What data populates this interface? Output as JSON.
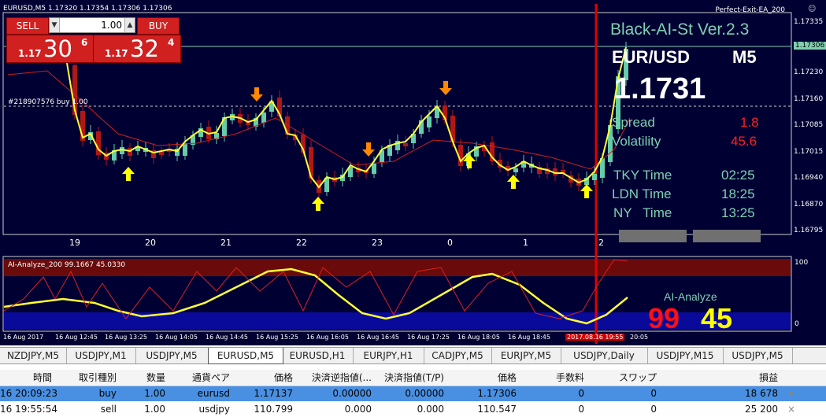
{
  "chart_header": "EURUSD,M5  1.17320 1.17354 1.17306 1.17306",
  "ea_name": "Perfect-Exit-EA_200",
  "trade_panel": {
    "sell_label": "SELL",
    "buy_label": "BUY",
    "lot": "1.00",
    "sell_small": "1.17",
    "sell_big": "30",
    "sell_sup": "6",
    "buy_small": "1.17",
    "buy_big": "32",
    "buy_sup": "4"
  },
  "order_line_label": "#218907576 buy 1.00",
  "info": {
    "title": "Black-AI-St Ver.2.3",
    "pair": "EUR/USD",
    "tf": "M5",
    "price": "1.1731",
    "spread_label": "Spread",
    "spread_value": "1.8",
    "volatility_label": "Volatility",
    "volatility_value": "45.6",
    "tky_label": "TKY Time",
    "tky_value": "02:25",
    "ldn_label": "LDN Time",
    "ldn_value": "18:25",
    "ny_label": "NY   Time",
    "ny_value": "13:25"
  },
  "price_axis": [
    "1.17335",
    "1.17306",
    "1.17230",
    "1.17160",
    "1.17085",
    "1.17015",
    "1.16940",
    "1.16870",
    "1.16795"
  ],
  "day_labels": [
    "19",
    "20",
    "21",
    "22",
    "23",
    "0",
    "1",
    "2"
  ],
  "indicator": {
    "label": "AI-Analyze_200 99.1667 45.0330",
    "axis_top": "100",
    "axis_bottom": "0",
    "name": "AI-Analyze",
    "value1": "99",
    "value2": "45"
  },
  "time_axis": [
    "16 Aug 2017",
    "16 Aug 12:45",
    "16 Aug 13:25",
    "16 Aug 14:05",
    "16 Aug 14:45",
    "16 Aug 15:25",
    "16 Aug 16:05",
    "16 Aug 16:45",
    "16 Aug 17:25",
    "16 Aug 18:05",
    "16 Aug 18:45",
    "2017.08.16 19:55",
    "20:05"
  ],
  "tabs": [
    "NZDJPY,M5",
    "USDJPY,M1",
    "USDJPY,M5",
    "EURUSD,M5",
    "EURUSD,H1",
    "EURJPY,H1",
    "CADJPY,M5",
    "EURJPY,M5",
    "USDJPY,Daily",
    "USDJPY,M15",
    "USDJPY,M5"
  ],
  "active_tab": "EURUSD,M5",
  "columns": [
    "時間",
    "取引種別",
    "数量",
    "通貨ペア",
    "価格",
    "決済逆指値(...",
    "決済指値(T/P)",
    "価格",
    "手数料",
    "スワップ",
    "損益"
  ],
  "rows": [
    [
      "16 20:09:23",
      "buy",
      "1.00",
      "eurusd",
      "1.17137",
      "0.00000",
      "0.00000",
      "1.17306",
      "0",
      "0",
      "18 678"
    ],
    [
      "16 19:55:54",
      "sell",
      "1.00",
      "usdjpy",
      "110.799",
      "0.000",
      "0.000",
      "110.547",
      "0",
      "0",
      "25 200"
    ]
  ],
  "close_glyph": "×",
  "colors": {
    "chart_bg": "#000033",
    "sell": "#d02020",
    "ma_yellow": "#ffff33",
    "candle_up": "#66ccaa",
    "candle_down": "#b01818",
    "arrow_up": "#ffff00",
    "arrow_down": "#ff8800",
    "vline": "#dd0000",
    "info_teal": "#7fd0b0",
    "info_red": "#ff2020",
    "selected_row": "#4a90e2"
  },
  "chart_data": {
    "type": "line",
    "title": "Black-AI-St Ver.2.3",
    "xlabel": "",
    "ylabel": "",
    "x": [
      "19",
      "20",
      "21",
      "22",
      "23",
      "0",
      "1",
      "2"
    ],
    "series": [
      {
        "values": [
          1.171,
          1.1705,
          1.1712,
          1.169,
          1.1713,
          1.1705,
          1.1698,
          1.1731
        ]
      },
      {
        "values": [
          1.1708,
          1.1706,
          1.171,
          1.1703,
          1.1707,
          1.1706,
          1.1704,
          1.172
        ]
      },
      {
        "name": "AI-Analyze_200",
        "values": [
          20,
          10,
          60,
          5,
          55,
          10,
          70,
          90
        ]
      }
    ],
    "ylim": [
      1.16795,
      1.17335
    ]
  }
}
